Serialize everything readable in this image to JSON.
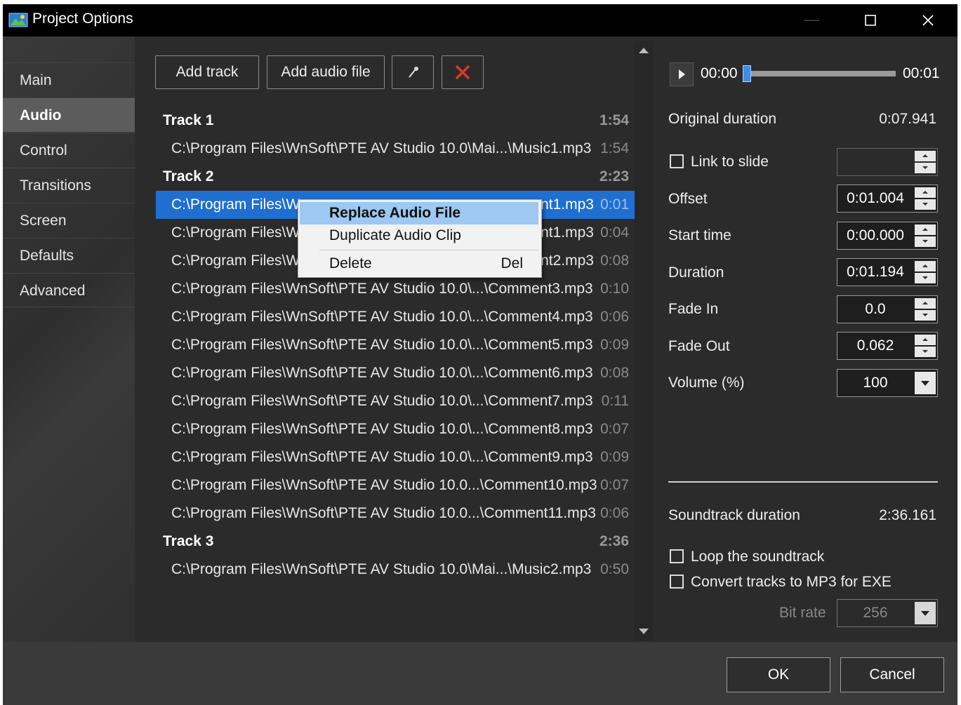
{
  "window": {
    "title": "Project Options",
    "icon": "pte-app-icon"
  },
  "sidebar": {
    "items": [
      {
        "label": "Main"
      },
      {
        "label": "Audio"
      },
      {
        "label": "Control"
      },
      {
        "label": "Transitions"
      },
      {
        "label": "Screen"
      },
      {
        "label": "Defaults"
      },
      {
        "label": "Advanced"
      }
    ],
    "active": "Audio"
  },
  "toolbar": {
    "add_track": "Add track",
    "add_audio_file": "Add audio file",
    "record_icon": "microphone-icon",
    "delete_icon": "red-x-icon"
  },
  "tracks": [
    {
      "name": "Track 1",
      "duration": "1:54",
      "files": [
        {
          "path": "C:\\Program Files\\WnSoft\\PTE AV Studio 10.0\\Mai...\\Music1.mp3",
          "duration": "1:54"
        }
      ]
    },
    {
      "name": "Track 2",
      "duration": "2:23",
      "files": [
        {
          "path": "C:\\Program Files\\W",
          "tail": "nt1.mp3",
          "duration": "0:01",
          "selected": true
        },
        {
          "path": "C:\\Program Files\\W",
          "tail": "nt1.mp3",
          "duration": "0:04"
        },
        {
          "path": "C:\\Program Files\\W",
          "tail": "nt2.mp3",
          "duration": "0:08"
        },
        {
          "path": "C:\\Program Files\\WnSoft\\PTE AV Studio 10.0\\...\\Comment3.mp3",
          "duration": "0:10"
        },
        {
          "path": "C:\\Program Files\\WnSoft\\PTE AV Studio 10.0\\...\\Comment4.mp3",
          "duration": "0:06"
        },
        {
          "path": "C:\\Program Files\\WnSoft\\PTE AV Studio 10.0\\...\\Comment5.mp3",
          "duration": "0:09"
        },
        {
          "path": "C:\\Program Files\\WnSoft\\PTE AV Studio 10.0\\...\\Comment6.mp3",
          "duration": "0:08"
        },
        {
          "path": "C:\\Program Files\\WnSoft\\PTE AV Studio 10.0\\...\\Comment7.mp3",
          "duration": "0:11"
        },
        {
          "path": "C:\\Program Files\\WnSoft\\PTE AV Studio 10.0\\...\\Comment8.mp3",
          "duration": "0:07"
        },
        {
          "path": "C:\\Program Files\\WnSoft\\PTE AV Studio 10.0\\...\\Comment9.mp3",
          "duration": "0:09"
        },
        {
          "path": "C:\\Program Files\\WnSoft\\PTE AV Studio 10.0...\\Comment10.mp3",
          "duration": "0:07"
        },
        {
          "path": "C:\\Program Files\\WnSoft\\PTE AV Studio 10.0...\\Comment11.mp3",
          "duration": "0:06"
        }
      ]
    },
    {
      "name": "Track 3",
      "duration": "2:36",
      "files": [
        {
          "path": "C:\\Program Files\\WnSoft\\PTE AV Studio 10.0\\Mai...\\Music2.mp3",
          "duration": "0:50"
        }
      ]
    }
  ],
  "context_menu": {
    "items": [
      {
        "label": "Replace Audio File",
        "shortcut": "",
        "highlighted": true
      },
      {
        "label": "Duplicate Audio Clip",
        "shortcut": ""
      },
      {
        "label": "Delete",
        "shortcut": "Del"
      }
    ]
  },
  "player": {
    "current": "00:00",
    "end": "00:01",
    "position": 0.0
  },
  "properties": {
    "original_duration_label": "Original duration",
    "original_duration_value": "0:07.941",
    "link_to_slide_label": "Link to slide",
    "link_to_slide_checked": false,
    "link_to_slide_value": "",
    "offset_label": "Offset",
    "offset_value": "0:01.004",
    "start_time_label": "Start time",
    "start_time_value": "0:00.000",
    "duration_label": "Duration",
    "duration_value": "0:01.194",
    "fade_in_label": "Fade In",
    "fade_in_value": "0.0",
    "fade_out_label": "Fade Out",
    "fade_out_value": "0.062",
    "volume_label": "Volume (%)",
    "volume_value": "100"
  },
  "soundtrack": {
    "duration_label": "Soundtrack duration",
    "duration_value": "2:36.161",
    "loop_label": "Loop the soundtrack",
    "loop_checked": false,
    "convert_label": "Convert tracks to MP3 for EXE",
    "convert_checked": false,
    "bitrate_label": "Bit rate",
    "bitrate_value": "256"
  },
  "footer": {
    "ok": "OK",
    "cancel": "Cancel"
  }
}
